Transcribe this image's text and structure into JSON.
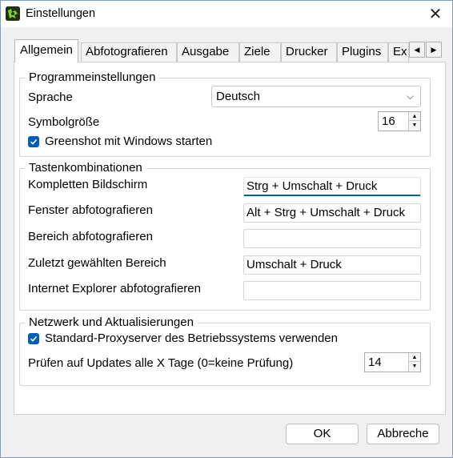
{
  "window": {
    "title": "Einstellungen"
  },
  "tabs": [
    "Allgemein",
    "Abfotografieren",
    "Ausgabe",
    "Ziele",
    "Drucker",
    "Plugins",
    "Ex"
  ],
  "program_settings": {
    "title": "Programmeinstellungen",
    "language_label": "Sprache",
    "language_value": "Deutsch",
    "icon_size_label": "Symbolgröße",
    "icon_size_value": "16",
    "autostart_label": "Greenshot mit Windows starten",
    "autostart_checked": true
  },
  "hotkeys": {
    "title": "Tastenkombinationen",
    "rows": [
      {
        "label": "Kompletten Bildschirm",
        "value": "Strg + Umschalt + Druck"
      },
      {
        "label": "Fenster abfotografieren",
        "value": "Alt + Strg + Umschalt + Druck"
      },
      {
        "label": "Bereich abfotografieren",
        "value": ""
      },
      {
        "label": "Zuletzt gewählten Bereich",
        "value": "Umschalt + Druck"
      },
      {
        "label": "Internet Explorer abfotografieren",
        "value": ""
      }
    ]
  },
  "network": {
    "title": "Netzwerk und Aktualisierungen",
    "proxy_label": "Standard-Proxyserver des Betriebssystems verwenden",
    "proxy_checked": true,
    "update_label": "Prüfen auf Updates alle X Tage (0=keine Prüfung)",
    "update_value": "14"
  },
  "buttons": {
    "ok": "OK",
    "cancel": "Abbreche"
  },
  "colors": {
    "accent": "#005fb8"
  }
}
